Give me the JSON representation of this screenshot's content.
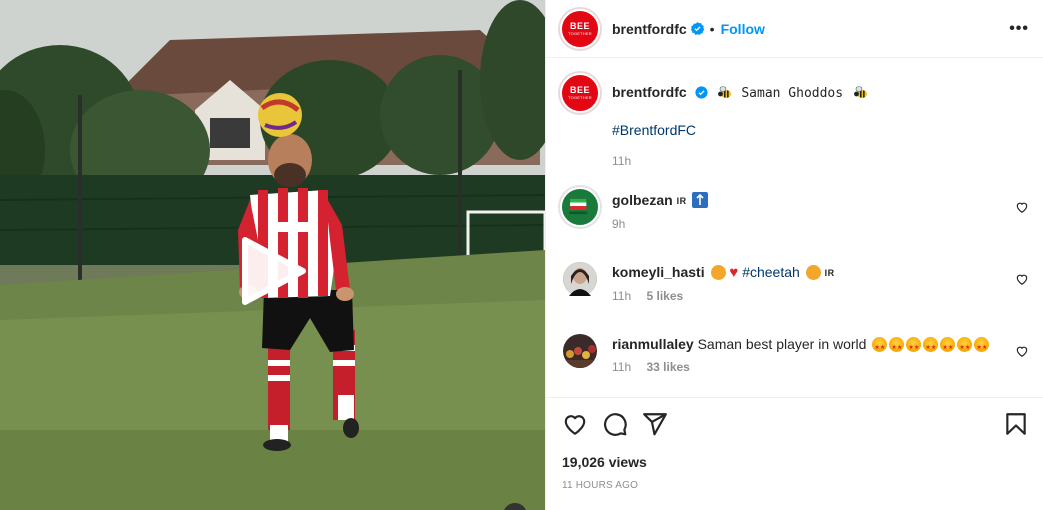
{
  "media": {
    "type": "video",
    "play_label": "Play"
  },
  "header": {
    "username": "brentfordfc",
    "avatar_text": "BEE",
    "avatar_subtext": "TOGETHER",
    "separator": "•",
    "follow_label": "Follow",
    "more_label": "•••"
  },
  "caption": {
    "username": "brentfordfc",
    "text": "Saman Ghoddos",
    "hashtag": "#BrentfordFC",
    "time": "11h"
  },
  "comments": [
    {
      "username": "golbezan",
      "flag": "IR",
      "text": "",
      "time": "9h",
      "likes": ""
    },
    {
      "username": "komeyli_hasti",
      "hashtag": "#cheetah",
      "flag": "IR",
      "time": "11h",
      "likes": "5 likes"
    },
    {
      "username": "rianmullaley",
      "text": "Saman best player in world",
      "time": "11h",
      "likes": "33 likes"
    }
  ],
  "stats": {
    "views": "19,026 views",
    "posted": "11 HOURS AGO"
  },
  "colors": {
    "accent": "#0095f6",
    "brand_red": "#e30613",
    "link": "#00376b",
    "muted": "#8e8e8e"
  }
}
